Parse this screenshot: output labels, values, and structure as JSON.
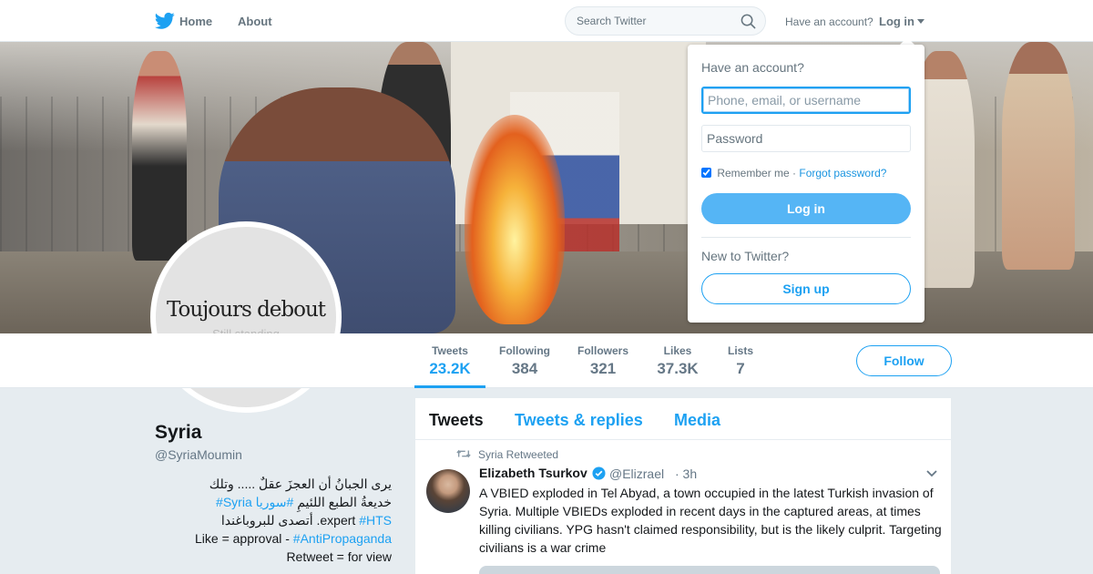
{
  "nav": {
    "logo_icon": "twitter-bird-icon",
    "home_label": "Home",
    "about_label": "About",
    "search_placeholder": "Search Twitter",
    "have_account_text": "Have an account?",
    "login_label": "Log in"
  },
  "header_image": {
    "description_icon": "header-photo"
  },
  "avatar": {
    "title": "Toujours debout",
    "subtitle": "Still standing"
  },
  "stats": [
    {
      "label": "Tweets",
      "value": "23.2K",
      "active": true
    },
    {
      "label": "Following",
      "value": "384",
      "active": false
    },
    {
      "label": "Followers",
      "value": "321",
      "active": false
    },
    {
      "label": "Likes",
      "value": "37.3K",
      "active": false
    },
    {
      "label": "Lists",
      "value": "7",
      "active": false
    }
  ],
  "follow_label": "Follow",
  "profile": {
    "name": "Syria",
    "handle": "@SyriaMoumin",
    "bio_line1": "يرى الجبانُ أن العجزَ عقلٌ ..... وتلك",
    "bio_line2_text": "خديعةُ الطبع اللئيمِ",
    "bio_line2_tag1": "#سوريا",
    "bio_line2_tag2": "#Syria",
    "bio_line3_tag": "#HTS",
    "bio_line3_text": "expert",
    "bio_line3_arabic": ". أتصدى للبروباغندا",
    "bio_line4_text": "Like = approval - ",
    "bio_line4_tag": "#AntiPropaganda",
    "bio_line5_text": "Retweet = for view"
  },
  "timeline": {
    "tabs": [
      "Tweets",
      "Tweets & replies",
      "Media"
    ],
    "retweet_context": "Syria Retweeted",
    "tweet": {
      "author_name": "Elizabeth Tsurkov",
      "author_handle": "@Elizrael",
      "time": "· 3h",
      "verified": true,
      "text": "A VBIED exploded in Tel Abyad, a town occupied in the latest Turkish invasion of Syria. Multiple VBIEDs exploded in recent days in the captured areas, at times killing civilians. YPG hasn't claimed responsibility, but is the likely culprit. Targeting civilians is a war crime"
    }
  },
  "login_dropdown": {
    "title": "Have an account?",
    "username_placeholder": "Phone, email, or username",
    "password_placeholder": "Password",
    "remember_label": "Remember me",
    "separator": " · ",
    "forgot_label": "Forgot password?",
    "remember_checked": true,
    "login_button": "Log in",
    "new_text": "New to Twitter?",
    "signup_button": "Sign up"
  },
  "colors": {
    "accent": "#1da1f2",
    "login_button": "#55b5f5",
    "text_muted": "#657786",
    "background": "#e6ecf0"
  }
}
